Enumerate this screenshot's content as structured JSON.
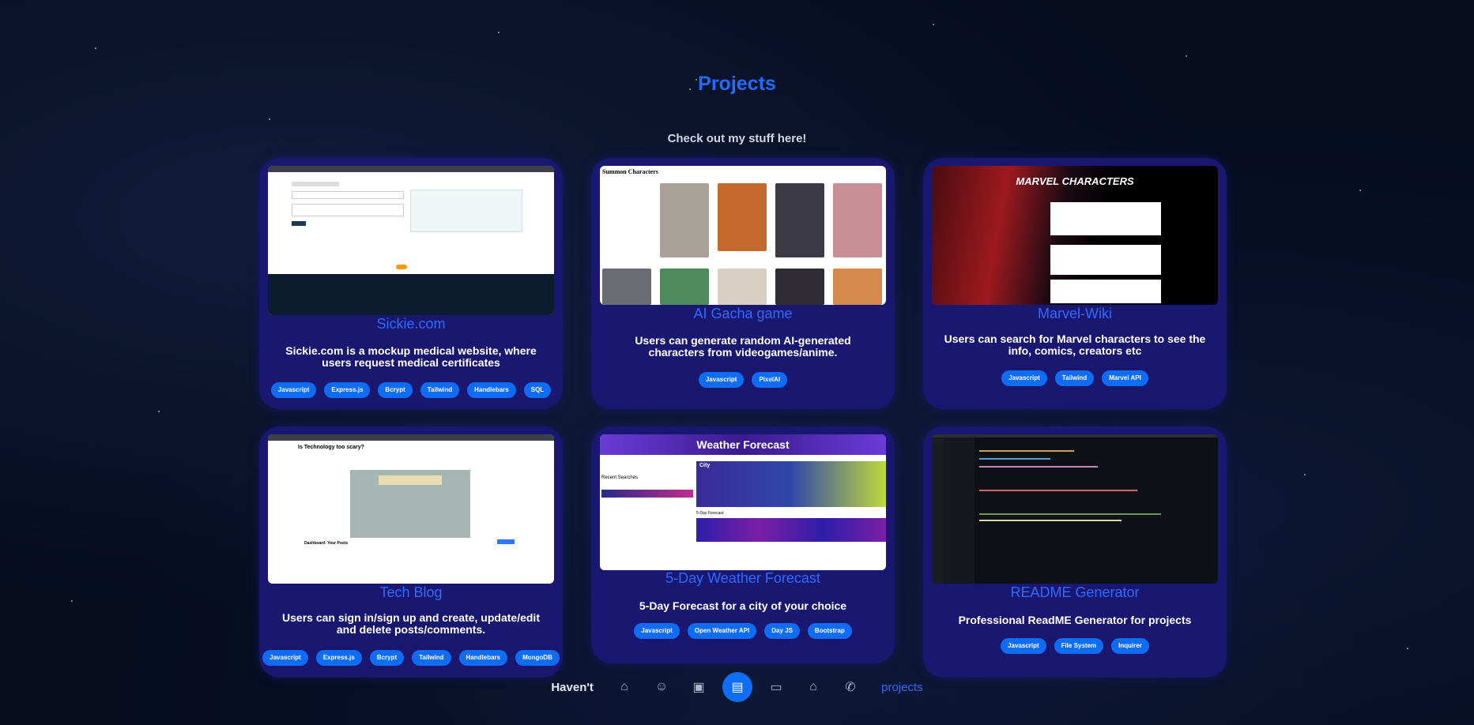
{
  "section": {
    "title": "Projects",
    "subtitle": "Check out my stuff here!"
  },
  "projects": [
    {
      "title": "Sickie.com",
      "description": "Sickie.com is a mockup medical website, where users request medical certificates",
      "tags": [
        "Javascript",
        "Express.js",
        "Bcrypt",
        "Tailwind",
        "Handlebars",
        "SQL"
      ]
    },
    {
      "title": "AI Gacha game",
      "description": "Users can generate random AI-generated characters from videogames/anime.",
      "tags": [
        "Javascript",
        "PixelAI"
      ],
      "screenshot_heading": "Summon Characters"
    },
    {
      "title": "Marvel-Wiki",
      "description": "Users can search for Marvel characters to see the info, comics, creators etc",
      "tags": [
        "Javascript",
        "Tailwind",
        "Marvel API"
      ],
      "screenshot_heading": "MARVEL CHARACTERS"
    },
    {
      "title": "Tech Blog",
      "description": "Users can sign in/sign up and create, update/edit and delete posts/comments.",
      "tags": [
        "Javascript",
        "Express.js",
        "Bcrypt",
        "Tailwind",
        "Handlebars",
        "MongoDB"
      ],
      "screenshot_heading": "Is Technology too scary?",
      "screenshot_section": "Dashboard: Your Posts"
    },
    {
      "title": "5-Day Weather Forecast",
      "description": "5-Day Forecast for a city of your choice",
      "tags": [
        "Javascript",
        "Open Weather API",
        "Day JS",
        "Bootstrap"
      ],
      "screenshot_heading": "Weather Forecast",
      "screenshot_city": "City",
      "screenshot_recent": "Recent Searches",
      "screenshot_forecast": "5-Day Forecast:"
    },
    {
      "title": "README Generator",
      "description": "Professional ReadME Generator for projects",
      "tags": [
        "Javascript",
        "File System",
        "Inquirer"
      ]
    }
  ],
  "footer": {
    "prefix": "Haven't",
    "link": "projects"
  },
  "nav": {
    "items": [
      {
        "icon": "home-icon",
        "glyph": "⌂"
      },
      {
        "icon": "user-icon",
        "glyph": "☺"
      },
      {
        "icon": "briefcase-icon",
        "glyph": "▣"
      },
      {
        "icon": "document-icon",
        "glyph": "▤"
      },
      {
        "icon": "folder-icon",
        "glyph": "▭"
      },
      {
        "icon": "school-icon",
        "glyph": "⌂"
      },
      {
        "icon": "phone-icon",
        "glyph": "✆"
      }
    ],
    "active_index": 3
  },
  "colors": {
    "accent": "#1f6cff",
    "card": "#1a1770",
    "tag": "#0f6df5",
    "background": "#060b1e"
  }
}
